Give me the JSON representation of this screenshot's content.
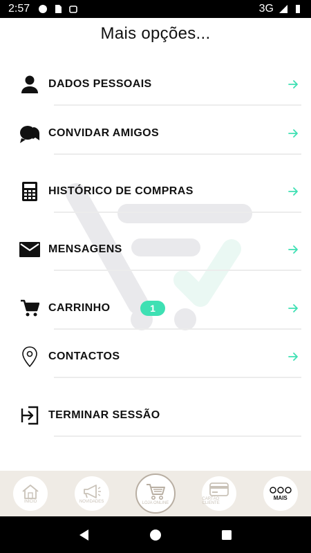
{
  "status_bar": {
    "time": "2:57",
    "network": "3G"
  },
  "page": {
    "title": "Mais opções..."
  },
  "menu": {
    "items": [
      {
        "label": "DADOS PESSOAIS",
        "icon": "person-icon"
      },
      {
        "label": "CONVIDAR AMIGOS",
        "icon": "chat-bubbles-icon"
      },
      {
        "label": "HISTÓRICO DE COMPRAS",
        "icon": "calculator-icon"
      },
      {
        "label": "MENSAGENS",
        "icon": "envelope-icon"
      },
      {
        "label": "CARRINHO",
        "icon": "cart-icon",
        "badge": "1"
      },
      {
        "label": "CONTACTOS",
        "icon": "map-pin-icon"
      },
      {
        "label": "TERMINAR SESSÃO",
        "icon": "logout-icon"
      }
    ]
  },
  "bottom_nav": {
    "tabs": [
      {
        "label": "INÍCIO",
        "icon": "home-icon"
      },
      {
        "label": "NOVIDADES",
        "icon": "megaphone-icon"
      },
      {
        "label": "LOJA ONLINE",
        "icon": "cart-icon",
        "active": true
      },
      {
        "label": "CARTÃO CLIENTE",
        "icon": "card-icon"
      },
      {
        "label": "MAIS",
        "icon": "more-circles-icon"
      }
    ]
  },
  "colors": {
    "accent": "#3ee0b3",
    "nav_background": "#efebe5",
    "nav_muted": "#c9c2b8"
  }
}
